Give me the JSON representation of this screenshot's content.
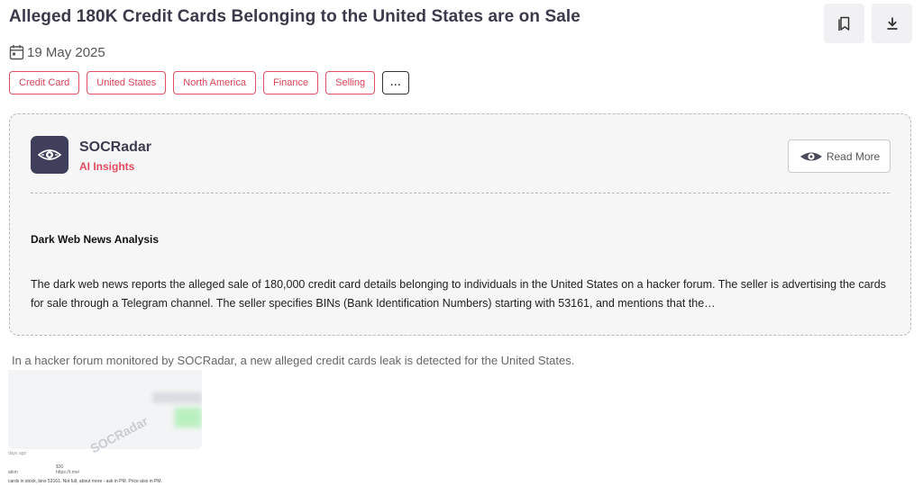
{
  "page": {
    "title": "Alleged 180K Credit Cards Belonging to the United States are on Sale",
    "date": "19 May 2025",
    "tags": [
      "Credit Card",
      "United States",
      "North America",
      "Finance",
      "Selling"
    ],
    "more_tags_label": "...",
    "icons": {
      "date": "calendar-icon",
      "bookmark": "bookmark-icon",
      "download": "download-icon"
    }
  },
  "card": {
    "brand_name": "SOCRadar",
    "brand_sub": "AI Insights",
    "read_more_label": "Read More",
    "section_heading": "Dark Web News Analysis",
    "summary": "The dark web news reports the alleged sale of 180,000 credit card details belonging to individuals in the United States on a hacker forum. The seller is advertising the cards for sale through a Telegram channel. The seller specifies BINs (Bank Identification Numbers) starting with 53161, and mentions that the…"
  },
  "intro": "In a hacker forum monitored by SOCRadar, a new alleged credit cards leak is detected for the United States.",
  "screenshot": {
    "watermark": "SOCRadar",
    "line_time": "days ago",
    "line_price": "$30",
    "line_link": "https://t.me/",
    "line_label": "ation",
    "line_text": "cards in stock, bins 53161. Not full, about more - ask in PM. Price also in PM."
  },
  "colors": {
    "accent": "#e04b60",
    "logo_bg": "#3f3f5c",
    "title": "#3a3a4a"
  }
}
